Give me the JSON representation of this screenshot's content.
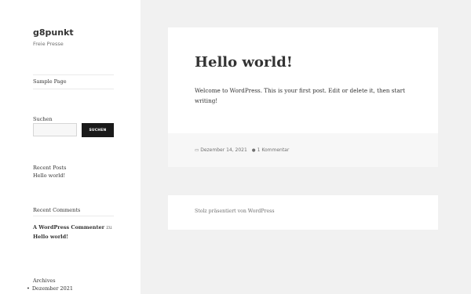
{
  "site": {
    "title": "g8punkt",
    "description": "Freie Presse"
  },
  "nav": {
    "items": [
      {
        "label": "Sample Page"
      }
    ]
  },
  "search": {
    "title": "Suchen",
    "placeholder": "",
    "button_label": "SUCHEN"
  },
  "recent_posts": {
    "title": "Recent Posts",
    "items": [
      {
        "label": "Hello world!"
      }
    ]
  },
  "recent_comments": {
    "title": "Recent Comments",
    "author": "A WordPress Commenter",
    "connector": "zu",
    "post": "Hello world!"
  },
  "archives": {
    "title": "Archives",
    "items": [
      {
        "label": "Dezember 2021"
      }
    ]
  },
  "post": {
    "title": "Hello world!",
    "body": "Welcome to WordPress. This is your first post. Edit or delete it, then start writing!",
    "date": "Dezember 14, 2021",
    "comments": "1 Kommentar",
    "date_icon": "calendar-icon",
    "comment_icon": "comment-icon"
  },
  "footer": {
    "powered_by": "Stolz präsentiert von WordPress"
  }
}
